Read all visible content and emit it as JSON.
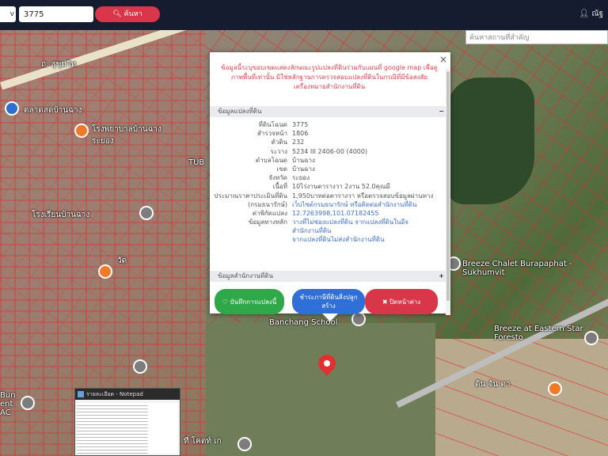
{
  "topbar": {
    "select_value": "v",
    "search_value": "3775",
    "search_button": "ค้นหา",
    "user_label": "ณัฐ"
  },
  "map": {
    "search_placeholder": "ค้นหาสถานที่สำคัญ",
    "labels": {
      "sukhumvit": "ถ. สุขุมวิท",
      "talat": "ตลาดสดบ้านฉาง",
      "hospital": "โรงพยาบาลบ้านฉาง ระยอง",
      "tub": "TUB",
      "school": "โรงเรียนบ้านฉาง",
      "breeze_chalet": "Breeze Chalet Burapaphat - Sukhumvit",
      "banchang_school": "Banchang School",
      "breeze_eastern": "Breeze at Eastern Star Foresto",
      "ban": "Bun ent AC",
      "bottom": "ที่ โคตท์ เก",
      "kin": "ดิน จัน ตา",
      "wat": "วัด"
    }
  },
  "popup": {
    "warning": "ข้อมูลนี้ระบุขอบเขตแสดงลักษณะรูปแปลงที่ดินร่วมกับแผนที่ google map เพื่อดูภาพพื้นที่เท่านั้น มิใช่หลักฐานการตรวจสอบแปลงที่ดินในกรณีที่มีข้อสงสัย เครื่องหมายสำนักงานที่ดิน",
    "section1": "ข้อมูลแปลงที่ดิน",
    "section1_toggle": "−",
    "rows": [
      {
        "k": "ที่ดินโฉนด",
        "v": "3775"
      },
      {
        "k": "สำรวจหน้า",
        "v": "1806"
      },
      {
        "k": "ตัวดิน",
        "v": "232"
      },
      {
        "k": "ระวาง",
        "v": "5234 III 2406-00 (4000)"
      },
      {
        "k": "ตำบลโฉนด",
        "v": "บ้านฉาง"
      },
      {
        "k": "เขต",
        "v": "บ้านฉาง"
      },
      {
        "k": "จังหวัด",
        "v": "ระยอง"
      },
      {
        "k": "เนื้อที่",
        "v": "10ไร่งานตารางวา 2งาน 52.0คุณมี"
      },
      {
        "k": "ประมาณราคาประเมินที่ดิน",
        "v": "1,950บาทต่อตารางวา หรือตรวจสอบข้อมูลผ่านทาง"
      },
      {
        "k": "(กรมธนารักษ์)",
        "v": "เว็บไซต์กรมธนารักษ์ หรือติดต่อสำนักงานที่ดิน",
        "link": true
      },
      {
        "k": "ค่าพิกัดแปลง",
        "v": "12.7263998,101.07182455",
        "link": true
      },
      {
        "k": "ข้อมูลทางหลัก",
        "v": "วางที่ไม่ช่องแปลงที่ดิน จากแปลงที่ดินในอีจ",
        "link": true
      },
      {
        "k": "",
        "v": "สำนักงานที่ดิน",
        "link": true
      },
      {
        "k": "",
        "v": "จากแปลงที่ดินไม่ส่งสำนักงานที่ดิน",
        "link": true
      }
    ],
    "section2": "ข้อมูลสำนักงานที่ดิน",
    "section2_toggle": "+",
    "btn_save": "♡ บันทึกการแปลงนี้",
    "btn_build": "ชำระภาษีที่ดินสิ่งปลูกสร้าง",
    "btn_close": "✖ ปิดหน้าต่าง"
  },
  "notepad": {
    "title": "รายละเอียด - Notepad"
  }
}
